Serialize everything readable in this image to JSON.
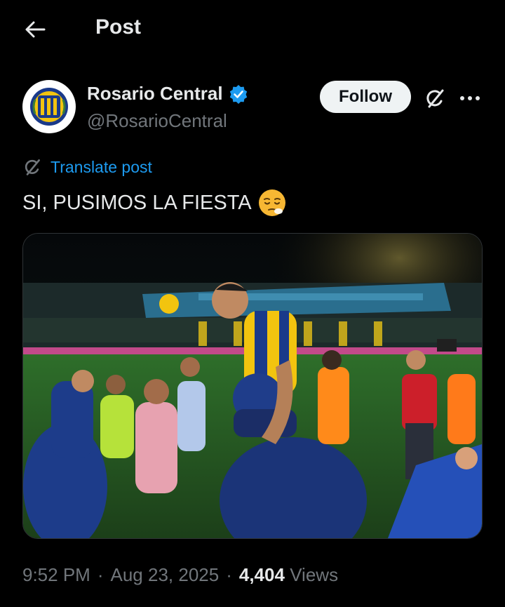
{
  "header": {
    "title": "Post",
    "back_icon": "arrow-left-icon"
  },
  "author": {
    "display_name": "Rosario Central",
    "handle": "@RosarioCentral",
    "verified": true,
    "verified_color": "#1d9bf0",
    "avatar_icon": "club-crest-icon"
  },
  "actions": {
    "follow_label": "Follow",
    "grok_icon": "grok-icon",
    "more_icon": "more-dots-icon"
  },
  "translate": {
    "label": "Translate post",
    "icon": "grok-icon",
    "color": "#1d9bf0"
  },
  "post": {
    "text": "SI, PUSIMOS LA FIESTA",
    "emoji": "relieved-face-emoji",
    "media_description_icon": "stadium-photo"
  },
  "meta": {
    "time": "9:52 PM",
    "separator": "·",
    "date": "Aug 23, 2025",
    "views_count": "4,404",
    "views_label": "Views"
  },
  "colors": {
    "background": "#000000",
    "text_primary": "#e7e9ea",
    "text_secondary": "#71767b",
    "accent": "#1d9bf0",
    "follow_bg": "#eff3f4"
  }
}
